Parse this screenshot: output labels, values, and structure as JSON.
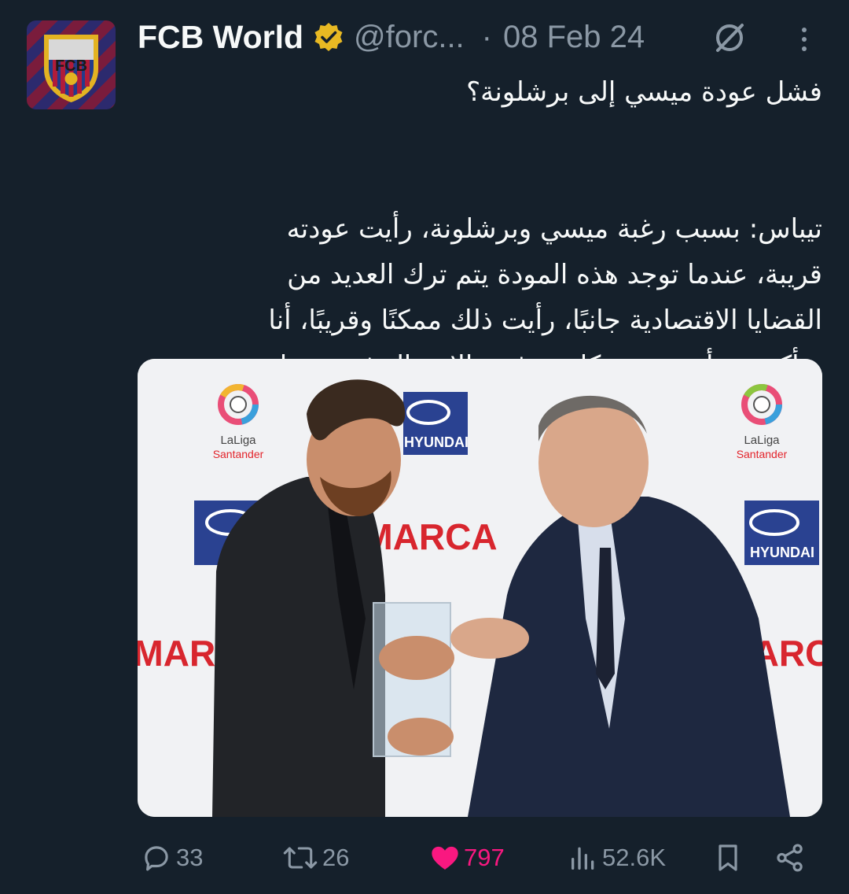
{
  "author": {
    "display_name": "FCB World",
    "handle": "@forc...",
    "verified_icon": "gold-verified-badge",
    "avatar_text": "FCB"
  },
  "date": "08 Feb 24",
  "separator": "·",
  "tweet": {
    "title": "فشل عودة ميسي إلى برشلونة؟",
    "body_lines": [
      "تيباس: بسبب رغبة ميسي وبرشلونة، رأيت عودته",
      "قريبة، عندما توجد هذه المودة يتم ترك العديد من",
      "القضايا الاقتصادية جانبًا، رأيت ذلك ممكنًا وقريبًا، أنا",
      "متأكد من أن ميسى كان يرغب بالاعتزال فى برشلونة."
    ]
  },
  "media": {
    "board_brands": [
      "LaLiga",
      "Santander",
      "HYUNDAI",
      "MARCA"
    ]
  },
  "actions": {
    "replies": "33",
    "retweets": "26",
    "likes": "797",
    "views": "52.6K"
  },
  "colors": {
    "background": "#15202b",
    "muted": "#8b98a5",
    "like": "#f91880",
    "verified": "#e8b923"
  }
}
